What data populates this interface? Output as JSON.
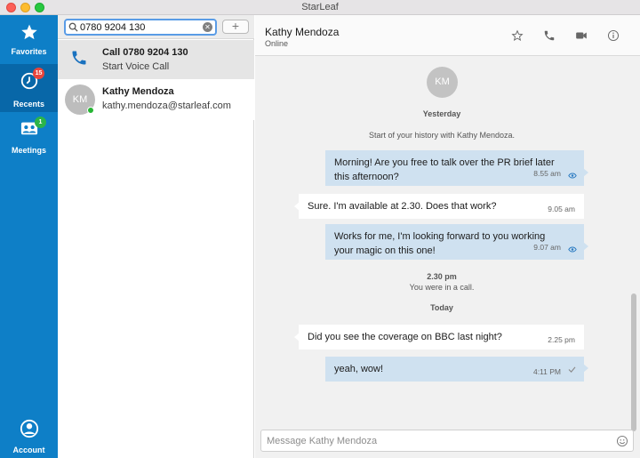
{
  "window": {
    "title": "StarLeaf"
  },
  "nav": {
    "favorites": "Favorites",
    "recents": "Recents",
    "recents_badge": "15",
    "meetings": "Meetings",
    "meetings_badge": "1",
    "account": "Account"
  },
  "search": {
    "value": "0780 9204 130"
  },
  "results": {
    "call": {
      "title": "Call 0780 9204 130",
      "subtitle": "Start Voice Call"
    },
    "contact": {
      "initials": "KM",
      "name": "Kathy Mendoza",
      "email": "kathy.mendoza@starleaf.com"
    }
  },
  "chat": {
    "name": "Kathy Mendoza",
    "status": "Online",
    "avatar_initials": "KM",
    "day1": "Yesterday",
    "history_note": "Start of your history with Kathy Mendoza.",
    "messages": [
      {
        "text1": "Morning! Are you free to talk over the PR brief later",
        "text2": "this afternoon?",
        "time": "8.55 am"
      },
      {
        "text1": "Sure. I'm available at 2.30. Does that work?",
        "time": "9.05 am"
      },
      {
        "text1": "Works for me, I'm looking forward to you working",
        "text2": "your magic on this one!",
        "time": "9.07 am"
      }
    ],
    "call_time": "2.30 pm",
    "call_note": "You were in a call.",
    "day2": "Today",
    "today_messages": [
      {
        "text1": "Did you see the coverage on BBC last night?",
        "time": "2.25 pm"
      },
      {
        "text1": "yeah, wow!",
        "time": "4:11 PM"
      }
    ],
    "composer_placeholder": "Message Kathy Mendoza"
  },
  "colors": {
    "nav_bg": "#0e7fc7",
    "nav_active": "#0867a8",
    "bubble_out": "#cfe1f0",
    "online": "#25b533"
  }
}
